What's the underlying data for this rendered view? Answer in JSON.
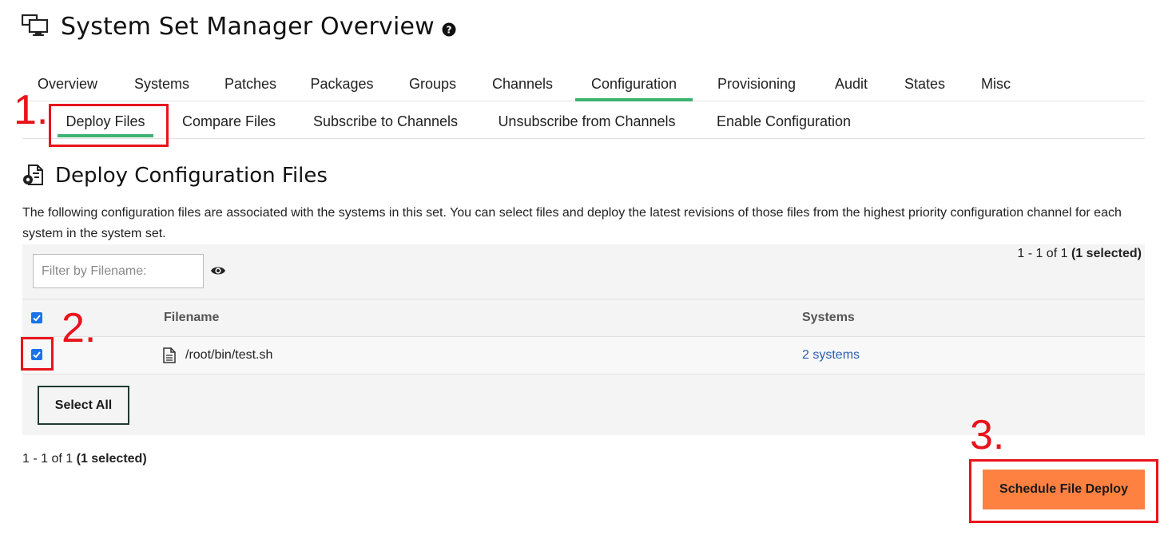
{
  "header": {
    "title": "System Set Manager Overview",
    "title_icon": "monitor-icon",
    "help_icon": "question-circle-icon"
  },
  "tabs": [
    {
      "label": "Overview"
    },
    {
      "label": "Systems"
    },
    {
      "label": "Patches"
    },
    {
      "label": "Packages"
    },
    {
      "label": "Groups"
    },
    {
      "label": "Channels"
    },
    {
      "label": "Configuration",
      "active": true
    },
    {
      "label": "Provisioning"
    },
    {
      "label": "Audit"
    },
    {
      "label": "States"
    },
    {
      "label": "Misc"
    }
  ],
  "subtabs": [
    {
      "label": "Deploy Files",
      "active": true
    },
    {
      "label": "Compare Files"
    },
    {
      "label": "Subscribe to Channels"
    },
    {
      "label": "Unsubscribe from Channels"
    },
    {
      "label": "Enable Configuration"
    }
  ],
  "section": {
    "title": "Deploy Configuration Files",
    "icon": "config-file-gear-icon",
    "description": "The following configuration files are associated with the systems in this set. You can select files and deploy the latest revisions of those files from the highest priority configuration channel for each system in the system set."
  },
  "filter": {
    "placeholder": "Filter by Filename:",
    "value": ""
  },
  "pager": {
    "range": "1 - 1 of 1",
    "selected": "(1 selected)"
  },
  "table": {
    "columns": [
      "Filename",
      "Systems"
    ],
    "rows": [
      {
        "filename": "/root/bin/test.sh",
        "systems": "2 systems",
        "checked": true
      }
    ]
  },
  "buttons": {
    "select_all": "Select All",
    "schedule": "Schedule File Deploy"
  },
  "annotations": [
    "1.",
    "2.",
    "3."
  ],
  "colors": {
    "accent_green": "#3cb371",
    "primary_orange": "#ff8142",
    "link_blue": "#2a5db0",
    "annotation_red": "#e8141c",
    "checkbox_blue": "#1a73e8"
  }
}
